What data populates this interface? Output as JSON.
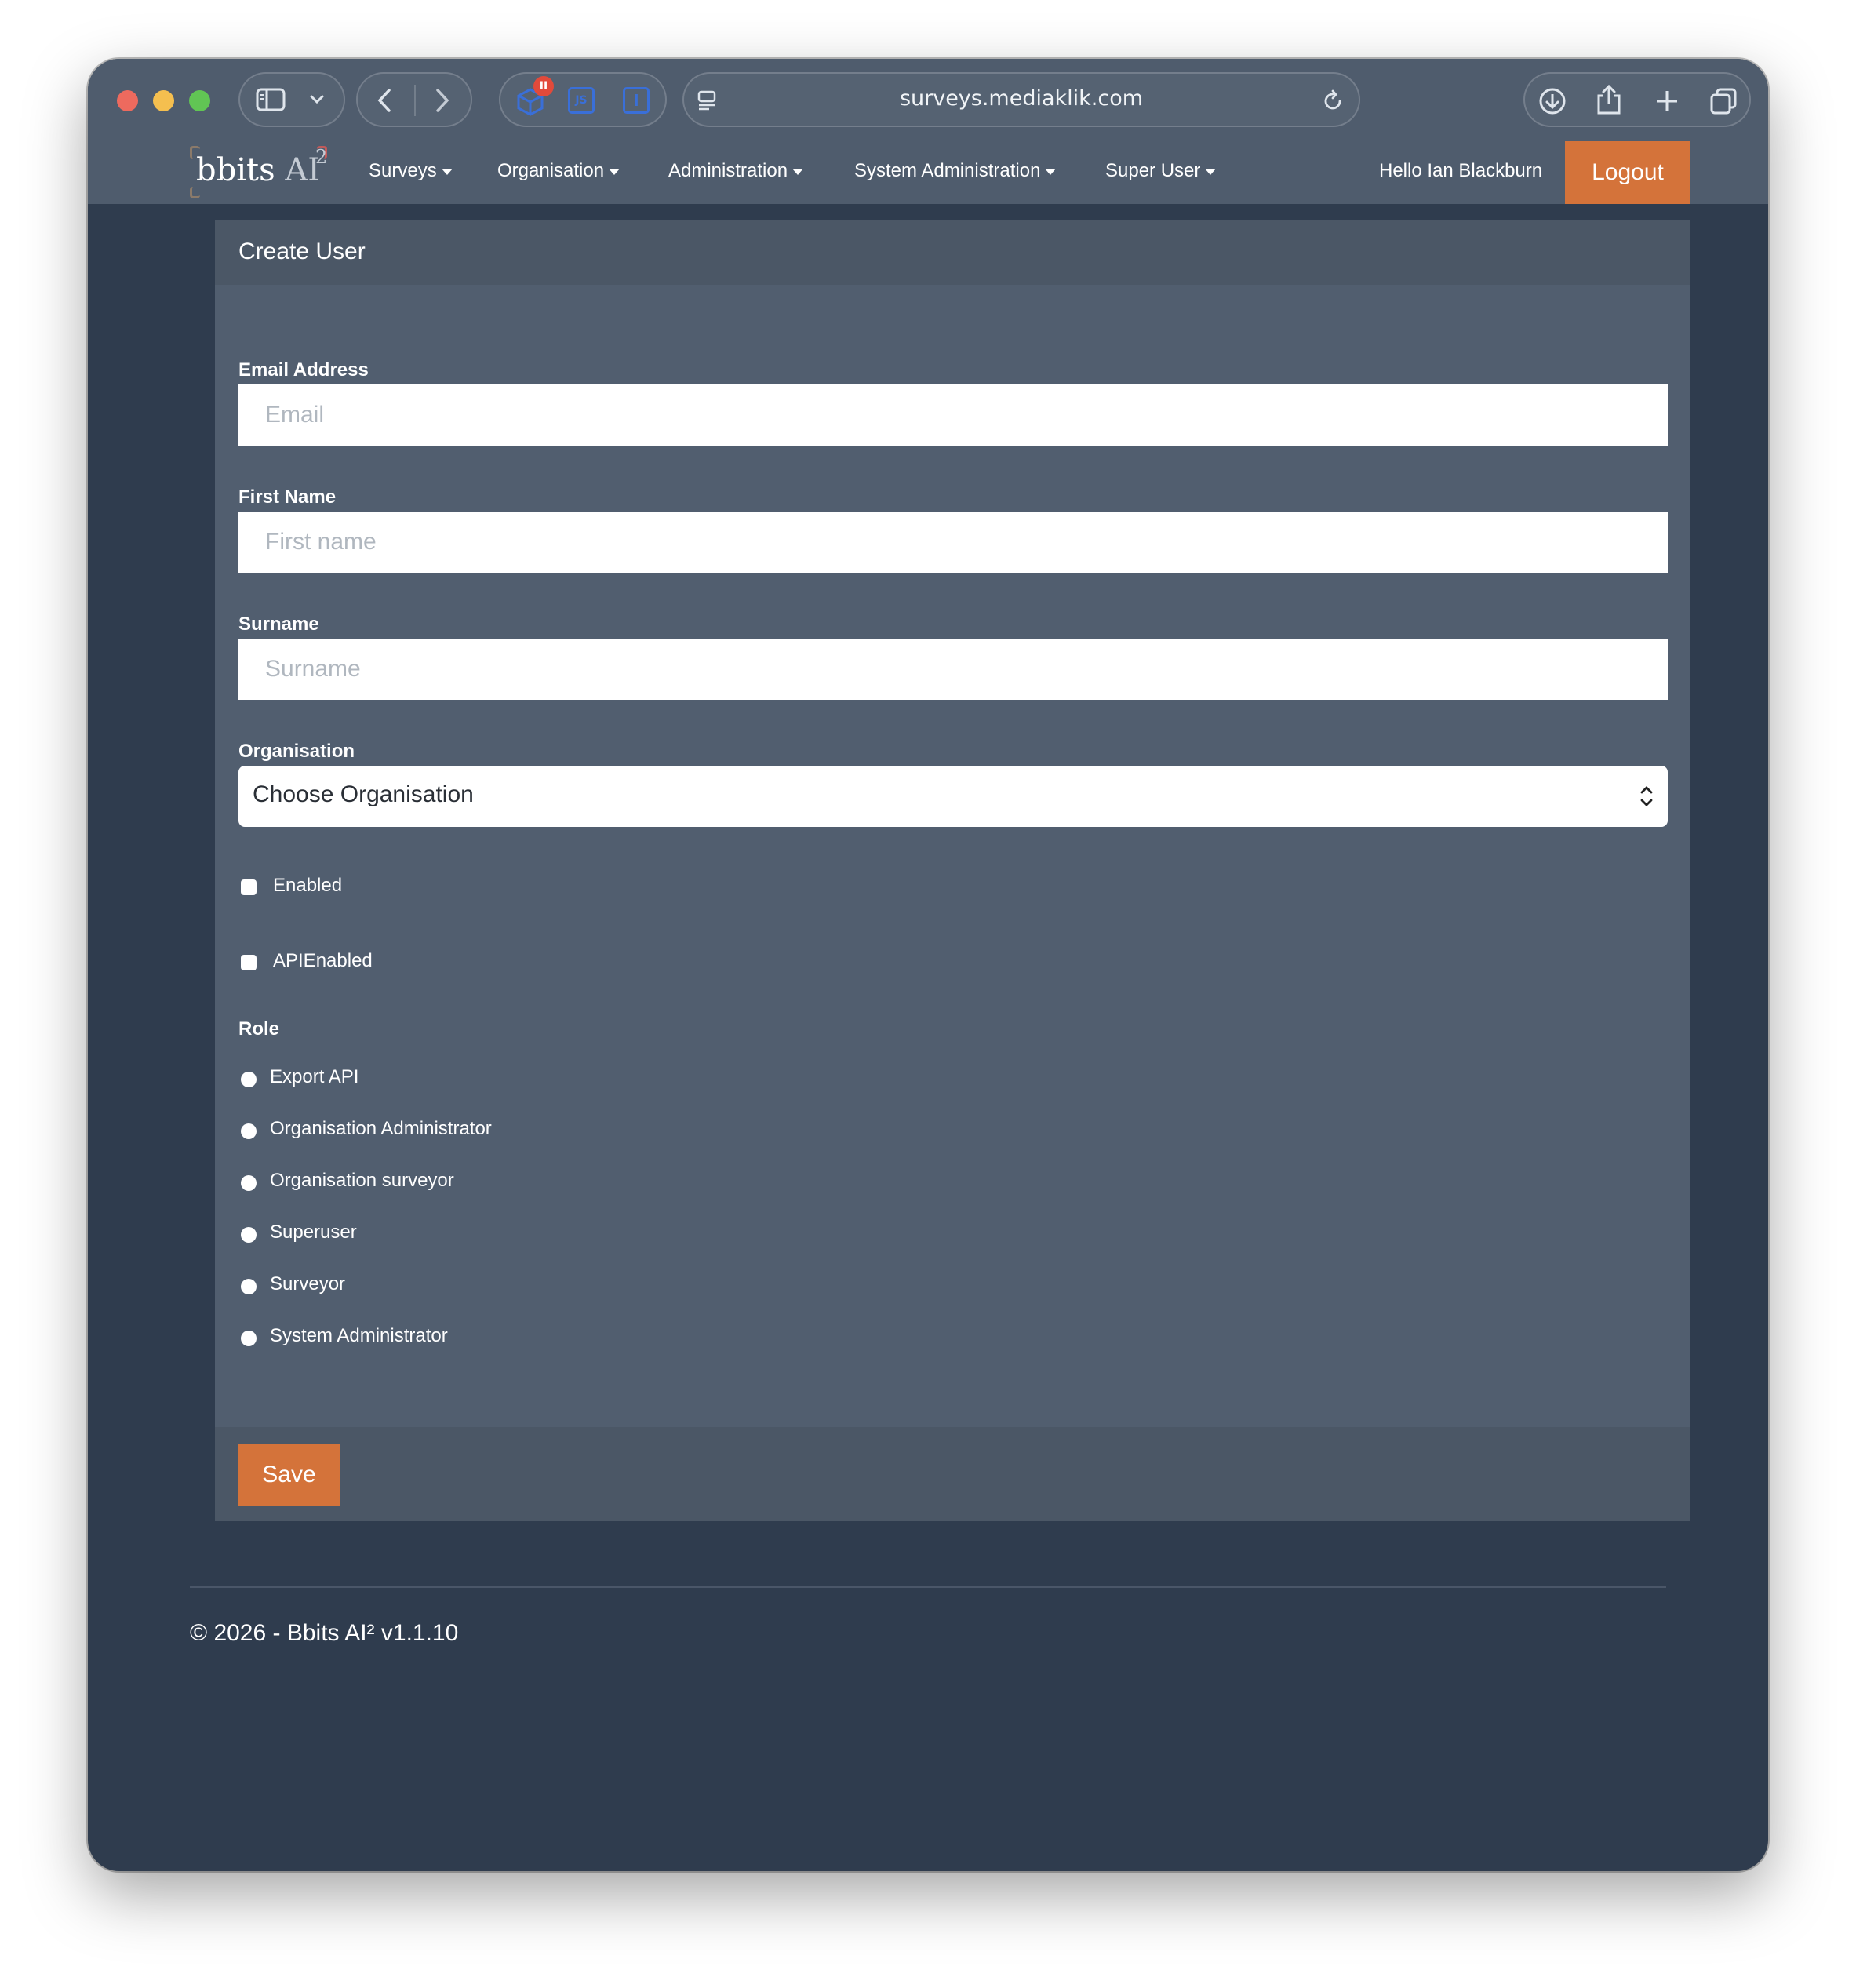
{
  "browser": {
    "url": "surveys.mediaklik.com",
    "extension_badge": "II",
    "extension_js": "JS",
    "extension_i": "I"
  },
  "brand": {
    "name": "bbits",
    "ai": "AI",
    "sup": "2"
  },
  "nav": {
    "items": [
      {
        "label": "Surveys"
      },
      {
        "label": "Organisation"
      },
      {
        "label": "Administration"
      },
      {
        "label": "System Administration"
      },
      {
        "label": "Super User"
      }
    ],
    "greeting": "Hello Ian Blackburn",
    "logout_label": "Logout"
  },
  "form": {
    "title": "Create User",
    "email": {
      "label": "Email Address",
      "placeholder": "Email",
      "value": ""
    },
    "first_name": {
      "label": "First Name",
      "placeholder": "First name",
      "value": ""
    },
    "surname": {
      "label": "Surname",
      "placeholder": "Surname",
      "value": ""
    },
    "organisation": {
      "label": "Organisation",
      "selected": "Choose Organisation"
    },
    "checkboxes": [
      {
        "label": "Enabled",
        "checked": false
      },
      {
        "label": "APIEnabled",
        "checked": false
      }
    ],
    "role": {
      "label": "Role",
      "options": [
        {
          "label": "Export API"
        },
        {
          "label": "Organisation Administrator"
        },
        {
          "label": "Organisation surveyor"
        },
        {
          "label": "Superuser"
        },
        {
          "label": "Surveyor"
        },
        {
          "label": "System Administrator"
        }
      ]
    },
    "save_label": "Save"
  },
  "footer": {
    "text": "© 2026 - Bbits AI² v1.1.10"
  },
  "colors": {
    "accent": "#d4733a",
    "page_bg": "#2f3c4e",
    "card_bg": "#515e6f",
    "card_header_bg": "#4b5766"
  }
}
